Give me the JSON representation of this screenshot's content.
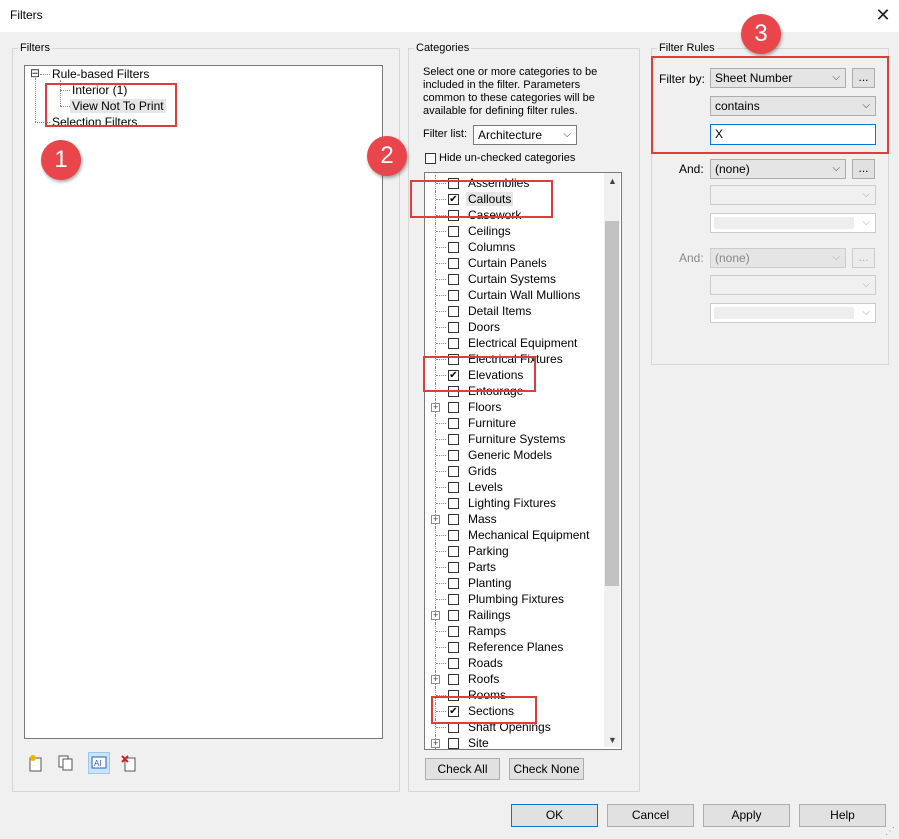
{
  "window": {
    "title": "Filters",
    "close_glyph": "✕"
  },
  "filters_panel": {
    "legend": "Filters",
    "tree": {
      "expand_glyph": "⊟",
      "rule_based": "Rule-based Filters",
      "interior": "Interior (1)",
      "view_not_to_print": "View Not To Print",
      "selection_filters": "Selection Filters"
    },
    "toolbar_icons": [
      "new-filter-icon",
      "duplicate-filter-icon",
      "rename-filter-icon",
      "delete-filter-icon"
    ]
  },
  "categories_panel": {
    "legend": "Categories",
    "description": "Select one or more categories to be included in the filter.  Parameters common to these categories will be available for defining filter rules.",
    "filter_list_label": "Filter list:",
    "filter_list_value": "Architecture",
    "hide_unchecked_label": "Hide un-checked categories",
    "items": [
      {
        "label": "Assemblies",
        "checked": false,
        "expandable": false
      },
      {
        "label": "Callouts",
        "checked": true,
        "expandable": false
      },
      {
        "label": "Casework",
        "checked": false,
        "expandable": false
      },
      {
        "label": "Ceilings",
        "checked": false,
        "expandable": false
      },
      {
        "label": "Columns",
        "checked": false,
        "expandable": false
      },
      {
        "label": "Curtain Panels",
        "checked": false,
        "expandable": false
      },
      {
        "label": "Curtain Systems",
        "checked": false,
        "expandable": false
      },
      {
        "label": "Curtain Wall Mullions",
        "checked": false,
        "expandable": false
      },
      {
        "label": "Detail Items",
        "checked": false,
        "expandable": false
      },
      {
        "label": "Doors",
        "checked": false,
        "expandable": false
      },
      {
        "label": "Electrical Equipment",
        "checked": false,
        "expandable": false
      },
      {
        "label": "Electrical Fixtures",
        "checked": false,
        "expandable": false
      },
      {
        "label": "Elevations",
        "checked": true,
        "expandable": false
      },
      {
        "label": "Entourage",
        "checked": false,
        "expandable": false
      },
      {
        "label": "Floors",
        "checked": false,
        "expandable": true
      },
      {
        "label": "Furniture",
        "checked": false,
        "expandable": false
      },
      {
        "label": "Furniture Systems",
        "checked": false,
        "expandable": false
      },
      {
        "label": "Generic Models",
        "checked": false,
        "expandable": false
      },
      {
        "label": "Grids",
        "checked": false,
        "expandable": false
      },
      {
        "label": "Levels",
        "checked": false,
        "expandable": false
      },
      {
        "label": "Lighting Fixtures",
        "checked": false,
        "expandable": false
      },
      {
        "label": "Mass",
        "checked": false,
        "expandable": true
      },
      {
        "label": "Mechanical Equipment",
        "checked": false,
        "expandable": false
      },
      {
        "label": "Parking",
        "checked": false,
        "expandable": false
      },
      {
        "label": "Parts",
        "checked": false,
        "expandable": false
      },
      {
        "label": "Planting",
        "checked": false,
        "expandable": false
      },
      {
        "label": "Plumbing Fixtures",
        "checked": false,
        "expandable": false
      },
      {
        "label": "Railings",
        "checked": false,
        "expandable": true
      },
      {
        "label": "Ramps",
        "checked": false,
        "expandable": false
      },
      {
        "label": "Reference Planes",
        "checked": false,
        "expandable": false
      },
      {
        "label": "Roads",
        "checked": false,
        "expandable": false
      },
      {
        "label": "Roofs",
        "checked": false,
        "expandable": true
      },
      {
        "label": "Rooms",
        "checked": false,
        "expandable": false
      },
      {
        "label": "Sections",
        "checked": true,
        "expandable": false
      },
      {
        "label": "Shaft Openings",
        "checked": false,
        "expandable": false
      },
      {
        "label": "Site",
        "checked": false,
        "expandable": true
      }
    ],
    "check_all": "Check All",
    "check_none": "Check None"
  },
  "rules_panel": {
    "legend": "Filter Rules",
    "filter_by_label": "Filter by:",
    "filter_by_value": "Sheet Number",
    "operator": "contains",
    "value": "X",
    "and1_label": "And:",
    "and1_value": "(none)",
    "and2_label": "And:",
    "and2_value": "(none)",
    "ellipsis": "..."
  },
  "footer": {
    "ok": "OK",
    "cancel": "Cancel",
    "apply": "Apply",
    "help": "Help"
  },
  "annotations": {
    "badge1": "1",
    "badge2": "2",
    "badge3": "3",
    "color": "#e03c3c"
  },
  "check_glyph": "✔",
  "plus_glyph": "+",
  "caret_glyph": "⌵"
}
